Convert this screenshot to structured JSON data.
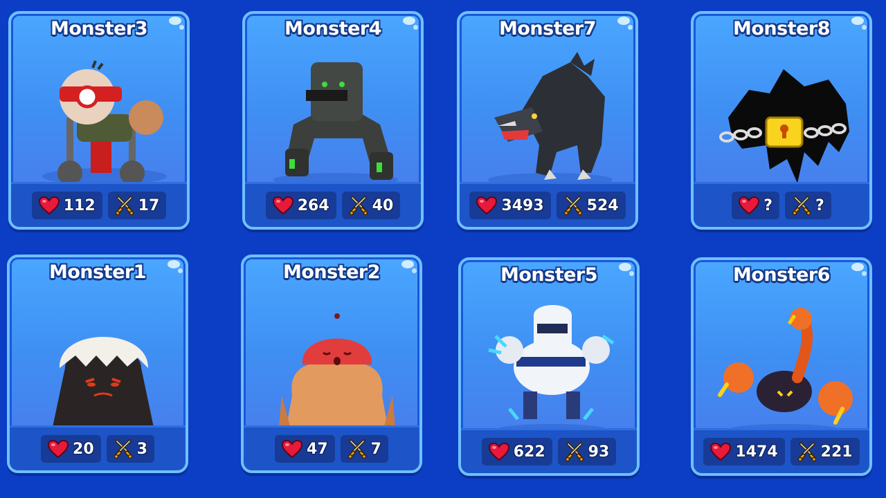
{
  "background_color": "#0b3ec4",
  "cards": [
    {
      "name": "Monster3",
      "hp": "112",
      "atk": "17",
      "creature": "robot-egghead"
    },
    {
      "name": "Monster4",
      "hp": "264",
      "atk": "40",
      "creature": "stone-golem"
    },
    {
      "name": "Monster7",
      "hp": "3493",
      "atk": "524",
      "creature": "black-wolf"
    },
    {
      "name": "Monster8",
      "hp": "?",
      "atk": "?",
      "creature": "locked-shadow"
    },
    {
      "name": "Monster1",
      "hp": "20",
      "atk": "3",
      "creature": "egg-shell-blob"
    },
    {
      "name": "Monster2",
      "hp": "47",
      "atk": "7",
      "creature": "mushroom-brute"
    },
    {
      "name": "Monster5",
      "hp": "622",
      "atk": "93",
      "creature": "ice-robot"
    },
    {
      "name": "Monster6",
      "hp": "1474",
      "atk": "221",
      "creature": "lava-scorpion"
    }
  ]
}
